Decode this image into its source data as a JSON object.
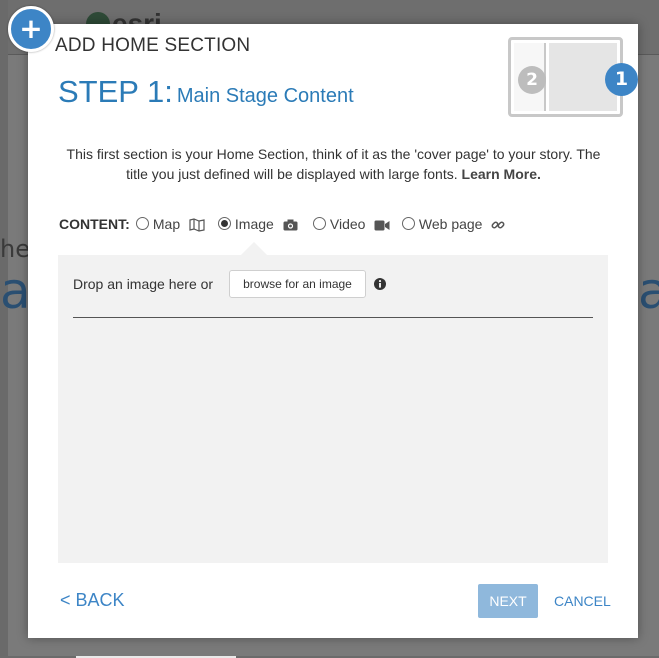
{
  "background": {
    "logo_text": "esri",
    "partial_word_left": "he",
    "partial_big_left": "a",
    "partial_big_right": "a"
  },
  "dialog": {
    "add_glyph": "+",
    "title": "ADD HOME SECTION",
    "step_label": "STEP 1:",
    "step_sub": "Main Stage Content",
    "layout_preview": {
      "badge_secondary": "2",
      "badge_primary": "1"
    },
    "intro_text": "This first section is your Home Section, think of it as the 'cover page' to your story. The title you just defined will be displayed with large fonts.",
    "learn_more": "Learn More.",
    "content": {
      "label": "CONTENT:",
      "options": [
        {
          "label": "Map",
          "icon": "map-icon",
          "selected": false
        },
        {
          "label": "Image",
          "icon": "camera-icon",
          "selected": true
        },
        {
          "label": "Video",
          "icon": "video-camera-icon",
          "selected": false
        },
        {
          "label": "Web page",
          "icon": "link-icon",
          "selected": false
        }
      ]
    },
    "image_panel": {
      "drop_text": "Drop an image here or",
      "browse_label": "browse for an image",
      "info_icon": "info-icon"
    },
    "footer": {
      "back_label": "< BACK",
      "next_label": "NEXT",
      "cancel_label": "CANCEL"
    }
  },
  "colors": {
    "accent": "#3d85c6",
    "next_disabled": "#8fb8dc",
    "step_heading": "#2b7bb7",
    "panel_bg": "#f2f2f2"
  }
}
